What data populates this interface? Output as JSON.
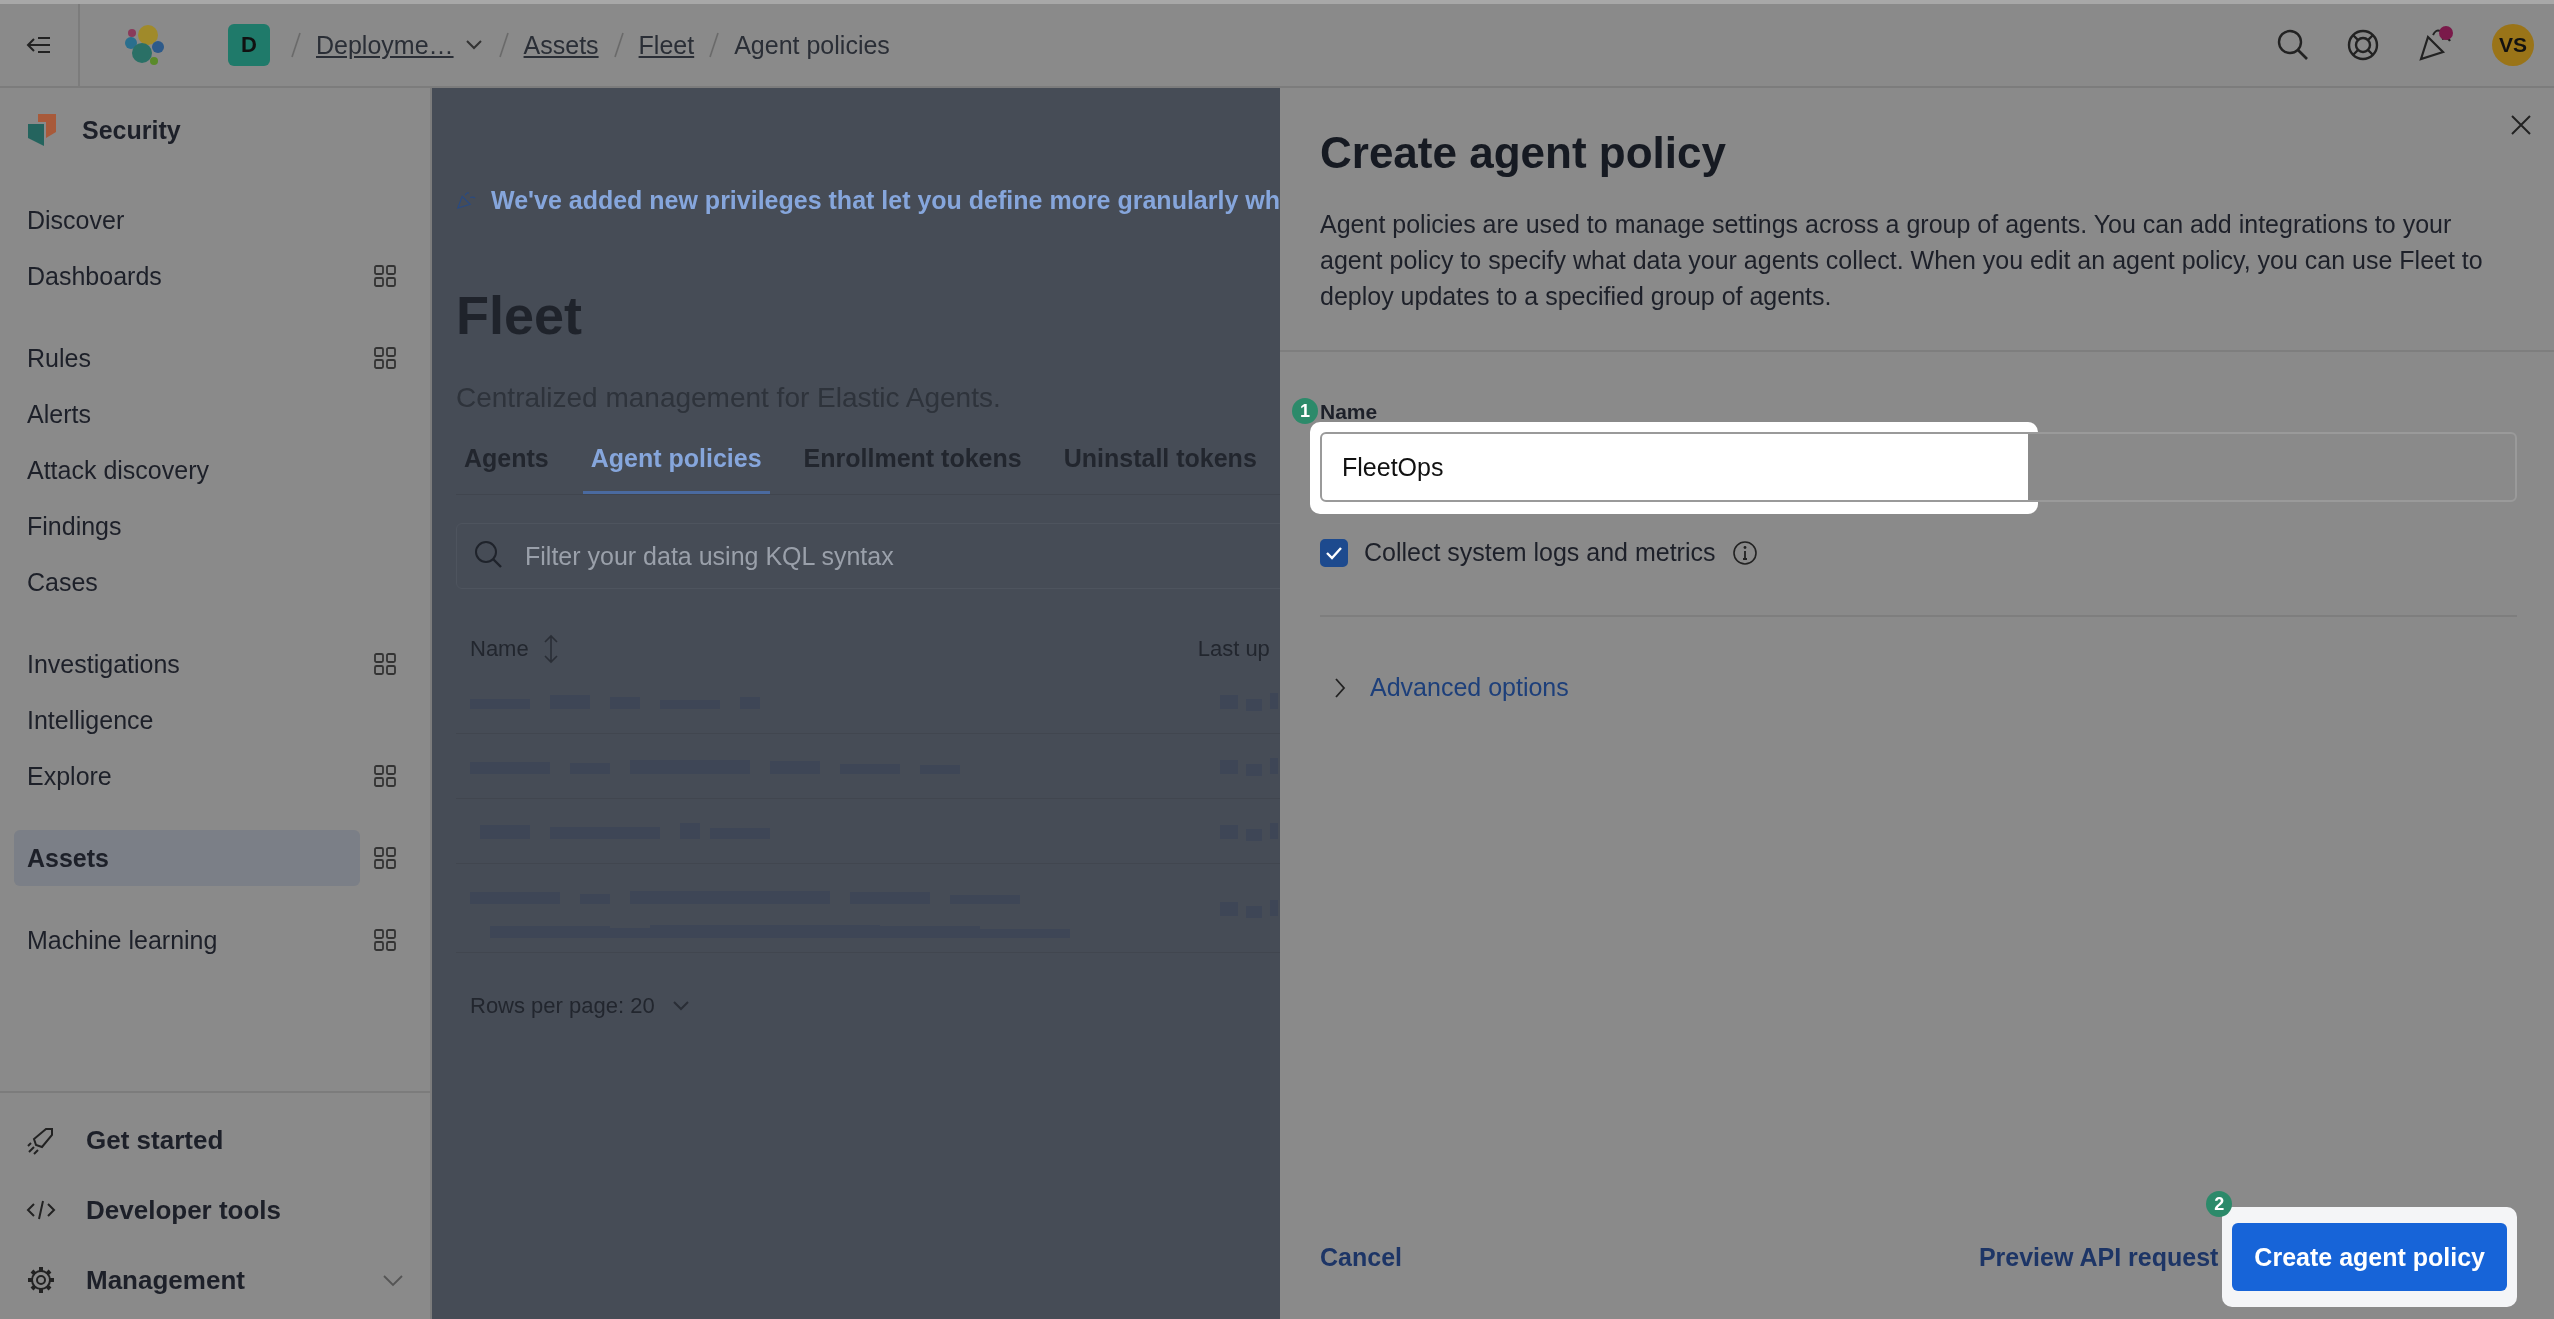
{
  "header": {
    "space_initial": "D",
    "breadcrumbs": [
      {
        "label": "Deployme…",
        "kind": "dropdown"
      },
      {
        "label": "Assets",
        "kind": "link"
      },
      {
        "label": "Fleet",
        "kind": "link"
      },
      {
        "label": "Agent policies",
        "kind": "current"
      }
    ],
    "news_unread": true,
    "avatar": "VS"
  },
  "sidebar": {
    "title": "Security",
    "groups": [
      [
        {
          "label": "Discover",
          "kind": "link",
          "selected": false
        },
        {
          "label": "Dashboards",
          "kind": "panel",
          "selected": false
        }
      ],
      [
        {
          "label": "Rules",
          "kind": "panel",
          "selected": false
        },
        {
          "label": "Alerts",
          "kind": "link",
          "selected": false
        },
        {
          "label": "Attack discovery",
          "kind": "link",
          "selected": false
        },
        {
          "label": "Findings",
          "kind": "link",
          "selected": false
        },
        {
          "label": "Cases",
          "kind": "link",
          "selected": false
        }
      ],
      [
        {
          "label": "Investigations",
          "kind": "panel",
          "selected": false
        },
        {
          "label": "Intelligence",
          "kind": "link",
          "selected": false
        },
        {
          "label": "Explore",
          "kind": "panel",
          "selected": false
        }
      ],
      [
        {
          "label": "Assets",
          "kind": "panel",
          "selected": true
        }
      ],
      [
        {
          "label": "Machine learning",
          "kind": "panel",
          "selected": false
        }
      ]
    ],
    "footer": [
      {
        "label": "Get started",
        "kind": "rocket"
      },
      {
        "label": "Developer tools",
        "kind": "code"
      },
      {
        "label": "Management",
        "kind": "gear",
        "expanded": false
      }
    ]
  },
  "page": {
    "callout": "We've added new privileges that let you define more granularly wh",
    "title": "Fleet",
    "subtitle": "Centralized management for Elastic Agents.",
    "tabs": [
      {
        "label": "Agents",
        "selected": false
      },
      {
        "label": "Agent policies",
        "selected": true
      },
      {
        "label": "Enrollment tokens",
        "selected": false
      },
      {
        "label": "Uninstall tokens",
        "selected": false
      }
    ],
    "search": {
      "placeholder": "Filter your data using KQL syntax"
    },
    "table": {
      "columns": [
        "Name",
        "Last up"
      ]
    },
    "rows_per_page": "Rows per page: 20"
  },
  "flyout": {
    "title": "Create agent policy",
    "description": "Agent policies are used to manage settings across a group of agents. You can add integrations to your agent policy to specify what data your agents collect. When you edit an agent policy, you can use Fleet to deploy updates to a specified group of agents.",
    "name_label": "Name",
    "name_value": "FleetOps",
    "name_step": "1",
    "collect_label": "Collect system logs and metrics",
    "collect_checked": true,
    "advanced": "Advanced options",
    "advanced_expanded": false,
    "cancel": "Cancel",
    "preview": "Preview API request",
    "create": "Create agent policy",
    "create_step": "2"
  }
}
